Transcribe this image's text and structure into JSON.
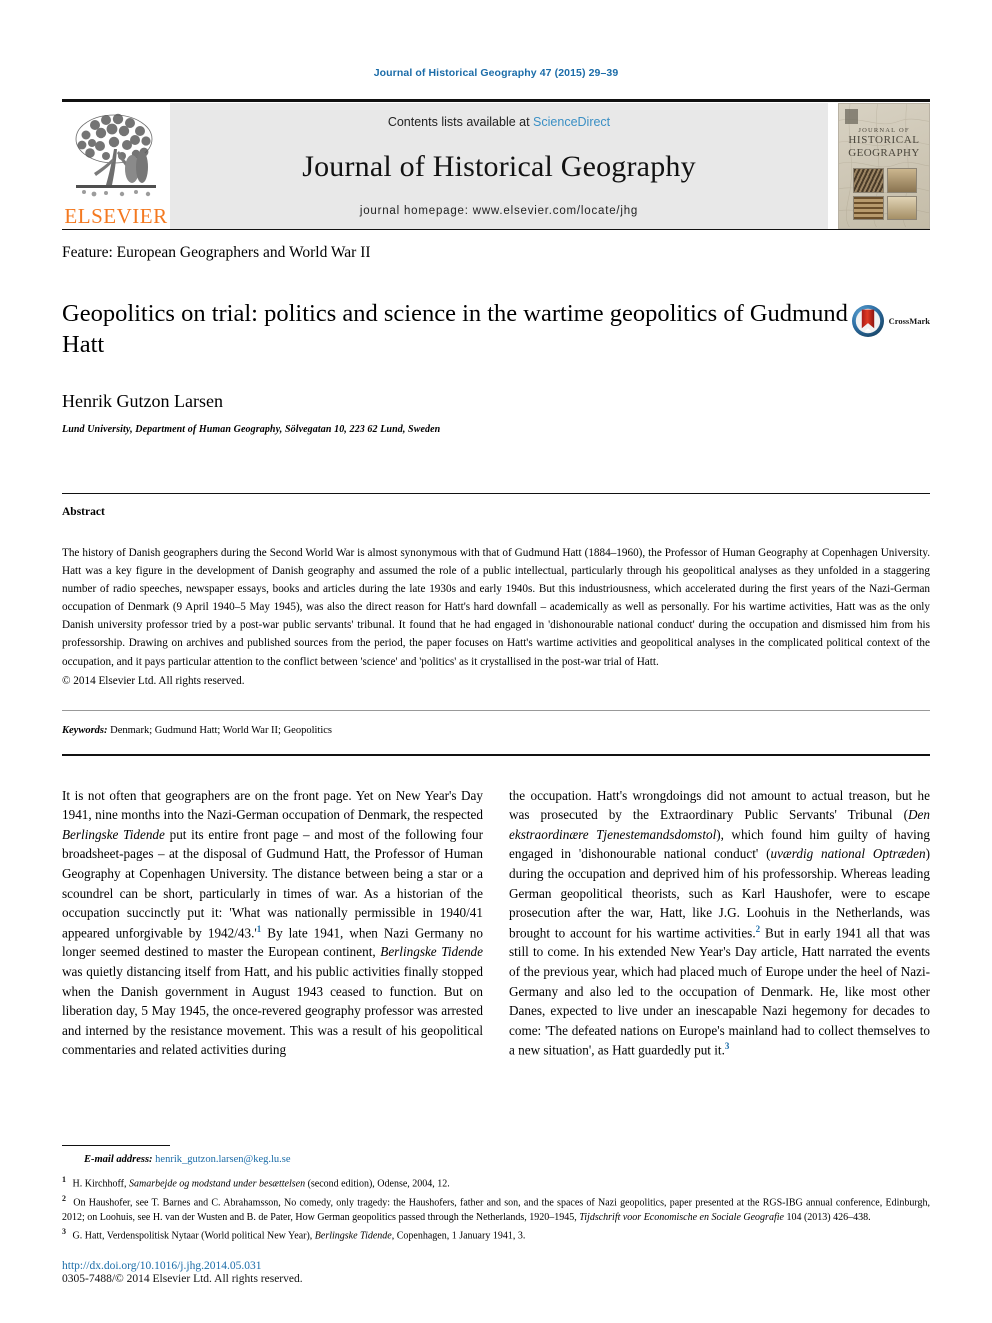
{
  "running_head": "Journal of Historical Geography 47 (2015) 29–39",
  "banner": {
    "elsevier_wordmark": "ELSEVIER",
    "elsevier_color": "#f47920",
    "contents_prefix": "Contents lists available at ",
    "contents_link": "ScienceDirect",
    "contents_link_color": "#3a8fc4",
    "journal_name": "Journal of Historical Geography",
    "homepage": "journal homepage: www.elsevier.com/locate/jhg",
    "cover": {
      "line1": "JOURNAL OF",
      "line2": "HISTORICAL",
      "line3": "GEOGRAPHY"
    }
  },
  "feature_line": "Feature: European Geographers and World War II",
  "article": {
    "title": "Geopolitics on trial: politics and science in the wartime geopolitics of Gudmund Hatt",
    "crossmark_label": "CrossMark",
    "author": "Henrik Gutzon Larsen",
    "affiliation": "Lund University, Department of Human Geography, Sölvegatan 10, 223 62 Lund, Sweden"
  },
  "abstract": {
    "heading": "Abstract",
    "body": "The history of Danish geographers during the Second World War is almost synonymous with that of Gudmund Hatt (1884–1960), the Professor of Human Geography at Copenhagen University. Hatt was a key figure in the development of Danish geography and assumed the role of a public intellectual, particularly through his geopolitical analyses as they unfolded in a staggering number of radio speeches, newspaper essays, books and articles during the late 1930s and early 1940s. But this industriousness, which accelerated during the first years of the Nazi-German occupation of Denmark (9 April 1940–5 May 1945), was also the direct reason for Hatt's hard downfall – academically as well as personally. For his wartime activities, Hatt was as the only Danish university professor tried by a post-war public servants' tribunal. It found that he had engaged in 'dishonourable national conduct' during the occupation and dismissed him from his professorship. Drawing on archives and published sources from the period, the paper focuses on Hatt's wartime activities and geopolitical analyses in the complicated political context of the occupation, and it pays particular attention to the conflict between 'science' and 'politics' as it crystallised in the post-war trial of Hatt.",
    "copyright": "© 2014 Elsevier Ltd. All rights reserved.",
    "keywords_label": "Keywords:",
    "keywords_value": " Denmark; Gudmund Hatt; World War II; Geopolitics"
  },
  "body": {
    "left_column": [
      {
        "t": "It is not often that geographers are on the front page. Yet on New Year's Day 1941, nine months into the Nazi-German occupation of Denmark, the respected "
      },
      {
        "t": "Berlingske Tidende",
        "i": true
      },
      {
        "t": " put its entire front page – and most of the following four broadsheet-pages – at the disposal of Gudmund Hatt, the Professor of Human Geography at Copenhagen University. The distance between being a star or a scoundrel can be short, particularly in times of war. As a historian of the occupation succinctly put it: 'What was nationally permissible in 1940/41 appeared unforgivable by 1942/43.'"
      },
      {
        "t": "1",
        "sup": true
      },
      {
        "t": " By late 1941, when Nazi Germany no longer seemed destined to master the European continent, "
      },
      {
        "t": "Berlingske Tidende",
        "i": true
      },
      {
        "t": " was quietly distancing itself from Hatt, and his public activities finally stopped when the Danish government in August 1943 ceased to function. But on liberation day, 5 May 1945, the once-revered geography professor was arrested and interned by the resistance movement. This was a result of his geopolitical commentaries and related activities during"
      }
    ],
    "right_column": [
      {
        "t": "the occupation. Hatt's wrongdoings did not amount to actual treason, but he was prosecuted by the Extraordinary Public Servants' Tribunal ("
      },
      {
        "t": "Den ekstraordinære Tjenestemandsdomstol",
        "i": true
      },
      {
        "t": "), which found him guilty of having engaged in 'dishonourable national conduct' ("
      },
      {
        "t": "uværdig national Optræden",
        "i": true
      },
      {
        "t": ") during the occupation and deprived him of his professorship. Whereas leading German geopolitical theorists, such as Karl Haushofer, were to escape prosecution after the war, Hatt, like J.G. Loohuis in the Netherlands, was brought to account for his wartime activities."
      },
      {
        "t": "2",
        "sup": true
      },
      {
        "t": " But in early 1941 all that was still to come. In his extended New Year's Day article, Hatt narrated the events of the previous year, which had placed much of Europe under the heel of Nazi-Germany and also led to the occupation of Denmark. He, like most other Danes, expected to live under an inescapable Nazi hegemony for decades to come: 'The defeated nations on Europe's mainland had to collect themselves to a new situation', as Hatt guardedly put it."
      },
      {
        "t": "3",
        "sup": true
      },
      {
        "t": ""
      }
    ]
  },
  "footer": {
    "email_label": "E-mail address:",
    "email_address": " henrik_gutzon.larsen@keg.lu.se",
    "notes": [
      [
        {
          "t": "1",
          "sup": true
        },
        {
          "t": " H. Kirchhoff, "
        },
        {
          "t": "Samarbejde og modstand under besættelsen",
          "i": true
        },
        {
          "t": " (second edition), Odense, 2004, 12."
        }
      ],
      [
        {
          "t": "2",
          "sup": true
        },
        {
          "t": " On Haushofer, see T. Barnes and C. Abrahamsson, No comedy, only tragedy: the Haushofers, father and son, and the spaces of Nazi geopolitics, paper presented at the RGS-IBG annual conference, Edinburgh, 2012; on Loohuis, see H. van der Wusten and B. de Pater, How German geopolitics passed through the Netherlands, 1920–1945, "
        },
        {
          "t": "Tijdschrift voor Economische en Sociale Geografie",
          "i": true
        },
        {
          "t": " 104 (2013) 426–438."
        }
      ],
      [
        {
          "t": "3",
          "sup": true
        },
        {
          "t": " G. Hatt, Verdenspolitisk Nytaar (World political New Year), "
        },
        {
          "t": "Berlingske Tidende",
          "i": true
        },
        {
          "t": ", Copenhagen, 1 January 1941, 3."
        }
      ]
    ],
    "doi": "http://dx.doi.org/10.1016/j.jhg.2014.05.031",
    "issn": "0305-7488/© 2014 Elsevier Ltd. All rights reserved.",
    "link_color": "#1b6ca8"
  }
}
